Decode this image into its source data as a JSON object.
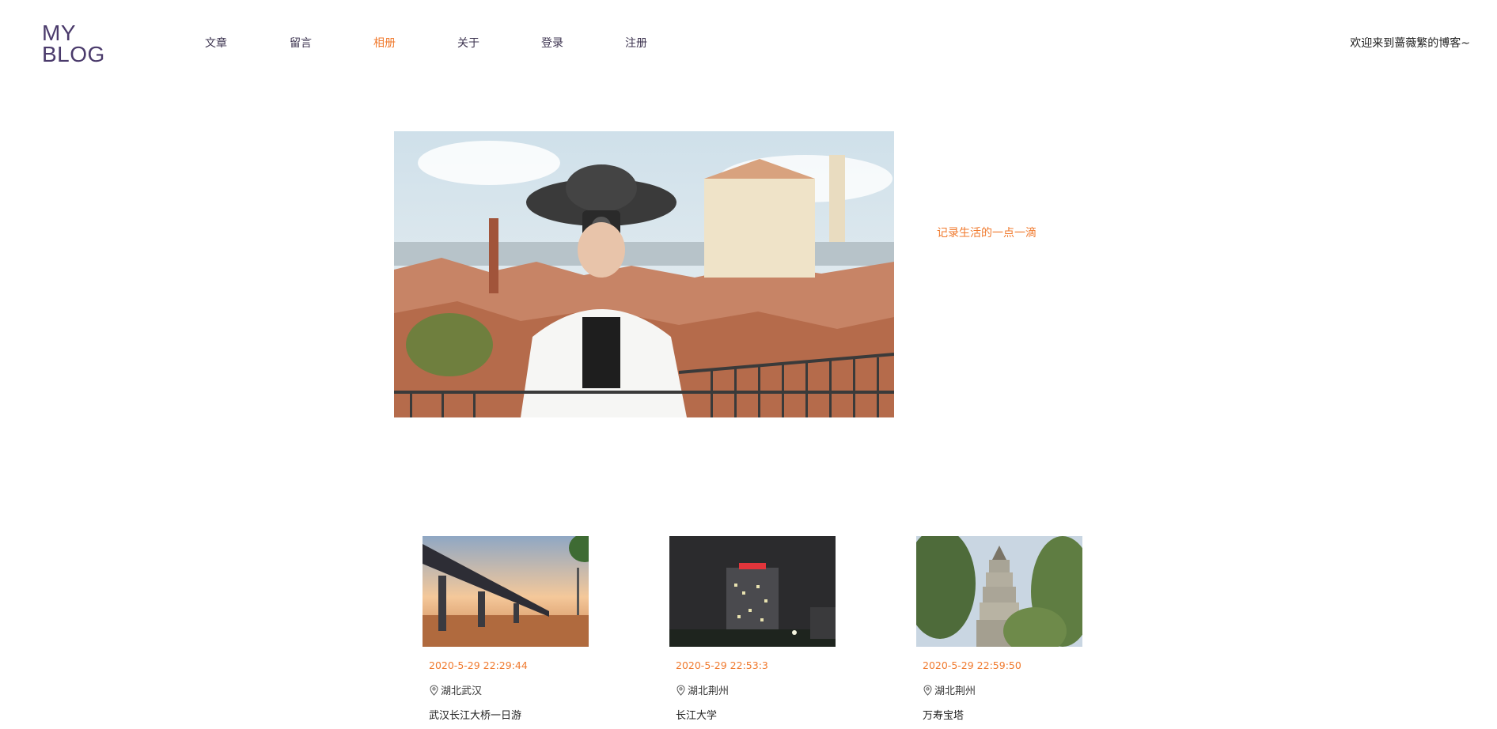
{
  "logo": {
    "line1": "MY",
    "line2": "BLOG"
  },
  "nav": {
    "items": [
      {
        "label": "文章",
        "active": false
      },
      {
        "label": "留言",
        "active": false
      },
      {
        "label": "相册",
        "active": true
      },
      {
        "label": "关于",
        "active": false
      },
      {
        "label": "登录",
        "active": false
      },
      {
        "label": "注册",
        "active": false
      }
    ]
  },
  "header": {
    "welcome": "欢迎来到蔷薇繁的博客~"
  },
  "hero": {
    "tagline": "记录生活的一点一滴"
  },
  "colors": {
    "accent": "#f07a2e",
    "logo": "#4a3a6b",
    "nav": "#3d3450"
  },
  "album": {
    "cards": [
      {
        "date": "2020-5-29 22:29:44",
        "location": "湖北武汉",
        "title": "武汉长江大桥一日游",
        "location_icon": "location-pin-icon"
      },
      {
        "date": "2020-5-29 22:53:3",
        "location": "湖北荆州",
        "title": "长江大学",
        "location_icon": "location-pin-icon"
      },
      {
        "date": "2020-5-29 22:59:50",
        "location": "湖北荆州",
        "title": "万寿宝塔",
        "location_icon": "location-pin-icon"
      }
    ]
  }
}
